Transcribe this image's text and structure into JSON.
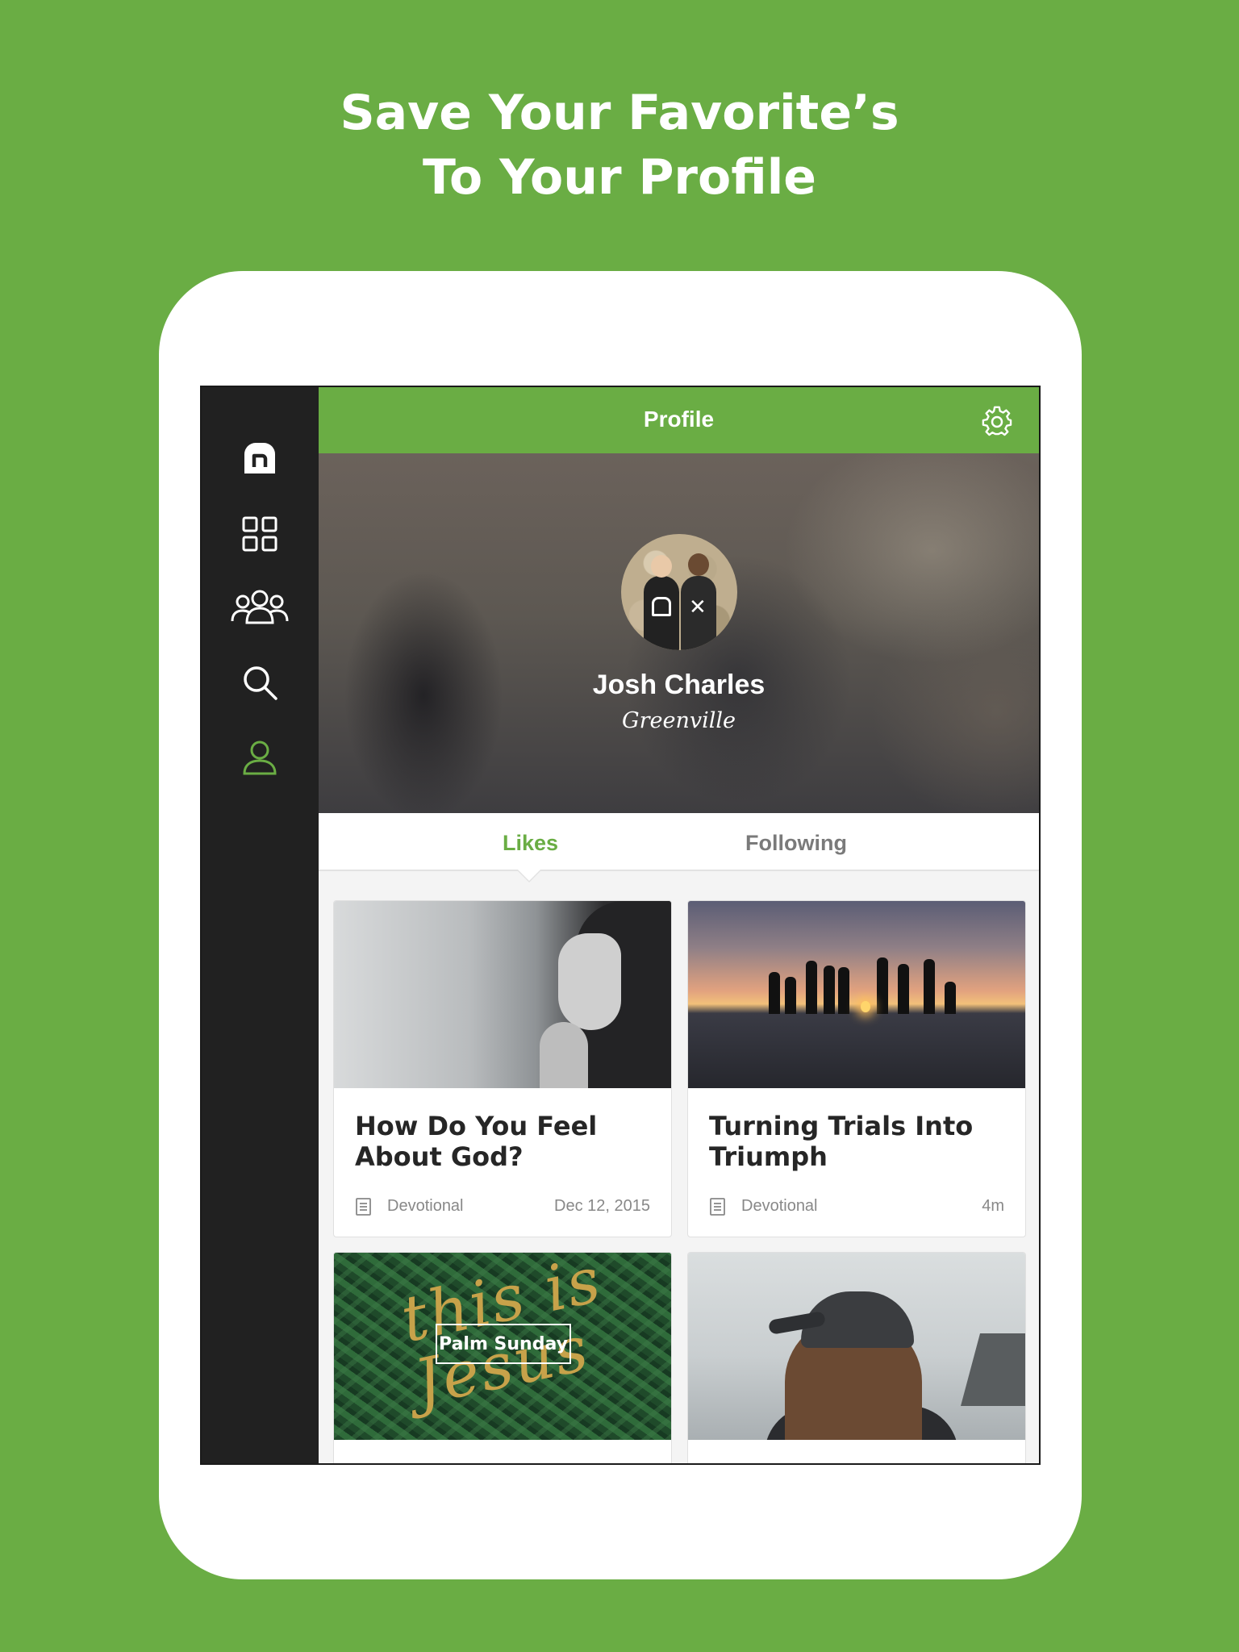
{
  "headline": {
    "line1": "Save Your Favorite’s",
    "line2": "To Your Profile"
  },
  "sidebar": {
    "items": [
      {
        "icon": "app-logo-icon"
      },
      {
        "icon": "grid-icon"
      },
      {
        "icon": "groups-icon"
      },
      {
        "icon": "search-icon"
      },
      {
        "icon": "profile-icon",
        "active": true
      }
    ]
  },
  "colors": {
    "brand_green": "#6aad44",
    "sidebar_bg": "#212121",
    "tab_inactive": "#7a7a7a"
  },
  "header": {
    "title": "Profile",
    "settings_icon": "gear-icon"
  },
  "profile": {
    "name": "Josh Charles",
    "location": "Greenville"
  },
  "tabs": [
    {
      "label": "Likes",
      "active": true
    },
    {
      "label": "Following",
      "active": false
    }
  ],
  "cards": [
    {
      "title": "How Do You Feel About God?",
      "type": "Devotional",
      "date": "Dec 12, 2015"
    },
    {
      "title": "Turning Trials Into Triumph",
      "type": "Devotional",
      "date": "4m"
    },
    {
      "image_badge": "Palm Sunday",
      "image_script": "this is Jesus"
    },
    {}
  ]
}
